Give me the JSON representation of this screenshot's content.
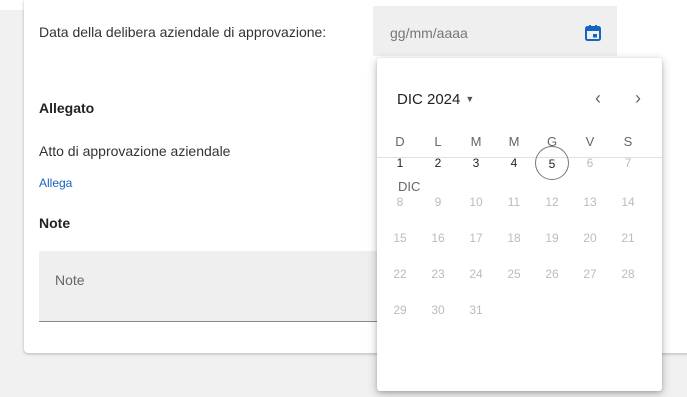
{
  "form": {
    "date_label": "Data della delibera aziendale di approvazione:",
    "date_placeholder": "gg/mm/aaaa",
    "allegato_title": "Allegato",
    "atto_label": "Atto di approvazione aziendale",
    "allega_link": "Allega",
    "note_title": "Note",
    "note_placeholder": "Note"
  },
  "calendar": {
    "month_year": "DIC 2024",
    "month_label": "DIC",
    "prev_icon": "‹",
    "next_icon": "›",
    "weekdays": [
      "D",
      "L",
      "M",
      "M",
      "G",
      "V",
      "S"
    ],
    "days": [
      "1",
      "2",
      "3",
      "4",
      "5",
      "6",
      "7",
      "8",
      "9",
      "10",
      "11",
      "12",
      "13",
      "14",
      "15",
      "16",
      "17",
      "18",
      "19",
      "20",
      "21",
      "22",
      "23",
      "24",
      "25",
      "26",
      "27",
      "28",
      "29",
      "30",
      "31"
    ],
    "today": 5,
    "enabled_through": 5,
    "accent_color": "#1565c0"
  }
}
